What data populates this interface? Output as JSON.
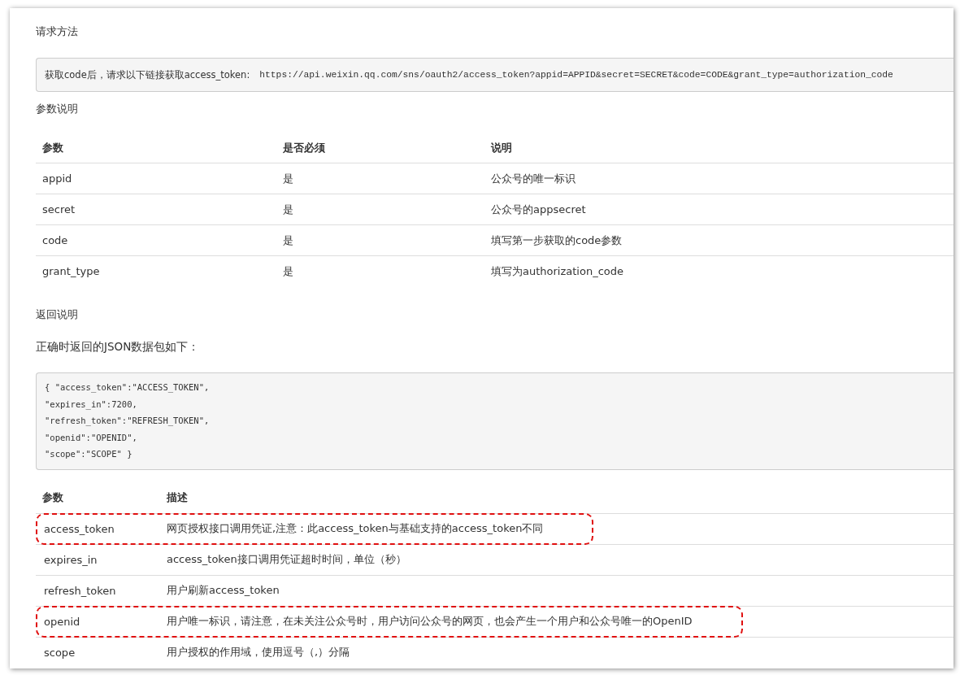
{
  "sections": {
    "request_method": "请求方法",
    "params_heading": "参数说明",
    "response_heading": "返回说明",
    "json_intro": "正确时返回的JSON数据包如下："
  },
  "request_code": {
    "prefix": "获取code后，请求以下链接获取access_token:",
    "url": "https://api.weixin.qq.com/sns/oauth2/access_token?appid=APPID&secret=SECRET&code=CODE&grant_type=authorization_code"
  },
  "params_table": {
    "columns": [
      "参数",
      "是否必须",
      "说明"
    ],
    "rows": [
      [
        "appid",
        "是",
        "公众号的唯一标识"
      ],
      [
        "secret",
        "是",
        "公众号的appsecret"
      ],
      [
        "code",
        "是",
        "填写第一步获取的code参数"
      ],
      [
        "grant_type",
        "是",
        "填写为authorization_code"
      ]
    ]
  },
  "json_example": [
    "{ \"access_token\":\"ACCESS_TOKEN\",",
    "\"expires_in\":7200,",
    "\"refresh_token\":\"REFRESH_TOKEN\",",
    "\"openid\":\"OPENID\",",
    "\"scope\":\"SCOPE\" }"
  ],
  "response_table": {
    "columns": [
      "参数",
      "描述"
    ],
    "rows": [
      {
        "param": "access_token",
        "description": "网页授权接口调用凭证,注意：此access_token与基础支持的access_token不同",
        "highlighted": true
      },
      {
        "param": "expires_in",
        "description": "access_token接口调用凭证超时时间，单位（秒）",
        "highlighted": false
      },
      {
        "param": "refresh_token",
        "description": "用户刷新access_token",
        "highlighted": false
      },
      {
        "param": "openid",
        "description": "用户唯一标识，请注意，在未关注公众号时，用户访问公众号的网页，也会产生一个用户和公众号唯一的OpenID",
        "highlighted": true
      },
      {
        "param": "scope",
        "description": "用户授权的作用域，使用逗号（,）分隔",
        "highlighted": false
      }
    ]
  }
}
